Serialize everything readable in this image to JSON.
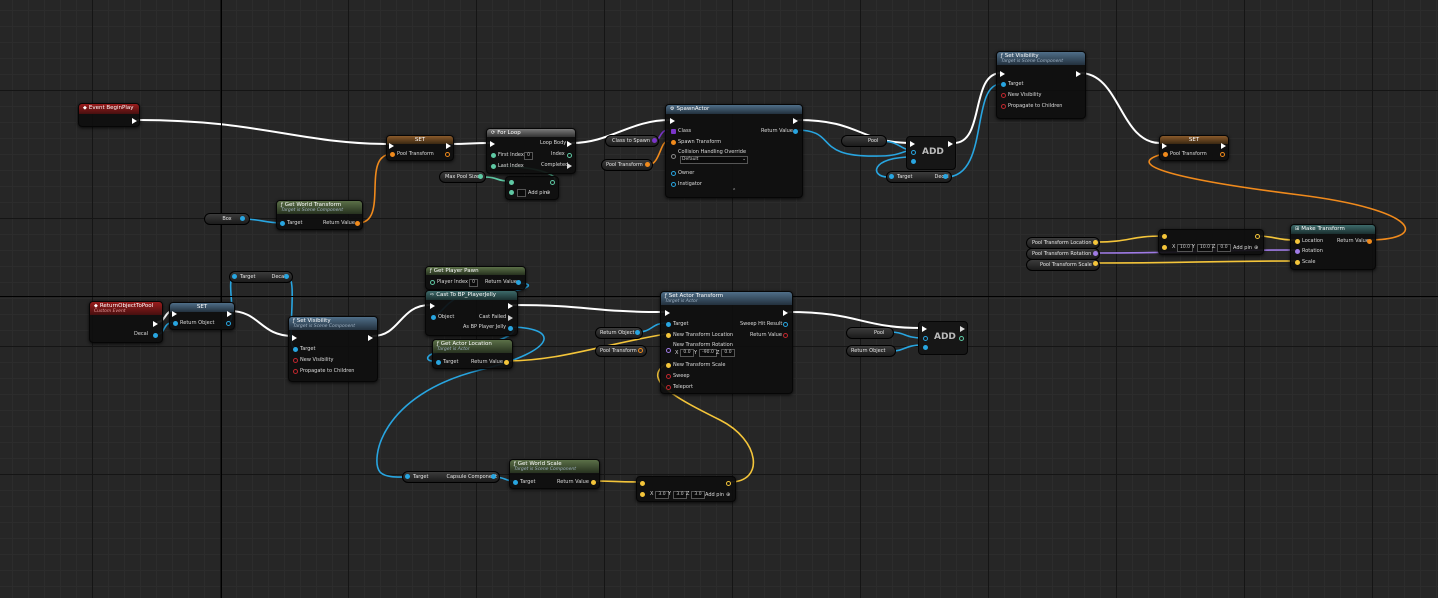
{
  "nodes": {
    "begin_play": {
      "title": "Event BeginPlay"
    },
    "set_pool_1": {
      "title": "SET",
      "pin": "Pool Transform"
    },
    "for_loop": {
      "title": "For Loop",
      "loop_body": "Loop Body",
      "first_index": "First Index",
      "first_index_val": "0",
      "index": "Index",
      "last_index": "Last Index",
      "completed": "Completed"
    },
    "max_pool_size": {
      "label": "Max Pool Size",
      "add_pin": "Add pin"
    },
    "get_world_transform": {
      "title": "Get World Transform",
      "subtitle": "Target is Scene Component",
      "target": "Target",
      "return": "Return Value"
    },
    "box": {
      "label": "Box"
    },
    "class_to_spawn": {
      "label": "Class to Spawn"
    },
    "pool_transform_var1": {
      "label": "Pool Transform"
    },
    "spawn_actor": {
      "title": "SpawnActor",
      "class": "Class",
      "spawn_transform": "Spawn Transform",
      "collision": "Collision Handling Override",
      "collision_val": "Default",
      "owner": "Owner",
      "instigator": "Instigator",
      "return": "Return Value"
    },
    "pool_get_1": {
      "label": "Pool"
    },
    "add_1": {
      "title": "ADD",
      "target": "Target",
      "decal": "Decal"
    },
    "set_visibility_top": {
      "title": "Set Visibility",
      "subtitle": "Target is Scene Component",
      "target": "Target",
      "new_visibility": "New Visibility",
      "propagate": "Propagate to Children"
    },
    "set_pool_2": {
      "title": "SET",
      "pin": "Pool Transform"
    },
    "make_transform": {
      "title": "Make Transform",
      "location": "Location",
      "rotation": "Rotation",
      "scale": "Scale",
      "return": "Return Value"
    },
    "vec_make": {
      "x": "10.0",
      "y": "10.0",
      "z": "0.0",
      "add_pin": "Add pin"
    },
    "pool_loc": {
      "label": "Pool Transform Location"
    },
    "pool_rot": {
      "label": "Pool Transform Rotation"
    },
    "pool_scale": {
      "label": "Pool Transform Scale"
    },
    "return_to_pool": {
      "title": "ReturnObjectToPool",
      "subtitle": "Custom Event",
      "decal": "Decal"
    },
    "set_return": {
      "title": "SET",
      "pin": "Return Object"
    },
    "target_decal": {
      "target": "Target",
      "decal": "Decal"
    },
    "set_visibility_bottom": {
      "title": "Set Visibility",
      "subtitle": "Target is Scene Component",
      "target": "Target",
      "new_visibility": "New Visibility",
      "propagate": "Propagate to Children"
    },
    "get_player_pawn": {
      "title": "Get Player Pawn",
      "player_index": "Player Index",
      "player_index_val": "0",
      "return": "Return Value"
    },
    "cast_jelly": {
      "title": "Cast To BP_PlayerJelly",
      "object": "Object",
      "cast_failed": "Cast Failed",
      "as": "As BP Player Jelly"
    },
    "get_actor_location": {
      "title": "Get Actor Location",
      "subtitle": "Target is Actor",
      "target": "Target",
      "return": "Return Value"
    },
    "set_actor_transform": {
      "title": "Set Actor Transform",
      "subtitle": "Target is Actor",
      "target": "Target",
      "sweep_hit": "Sweep Hit Result",
      "new_loc": "New Transform Location",
      "return": "Return Value",
      "new_rot": "New Transform Rotation",
      "rx": "0.0",
      "ry": "-90.0",
      "rz": "0.0",
      "new_scale": "New Transform Scale",
      "sweep": "Sweep",
      "teleport": "Teleport"
    },
    "return_object_var": {
      "label": "Return Object"
    },
    "pool_transform_var2": {
      "label": "Pool Transform"
    },
    "pool_get_2": {
      "label": "Pool"
    },
    "return_object_var2": {
      "label": "Return Object"
    },
    "add_2": {
      "title": "ADD"
    },
    "target_capsule": {
      "target": "Target",
      "capsule": "Capsule Component"
    },
    "get_world_scale": {
      "title": "Get World Scale",
      "subtitle": "Target is Scene Component",
      "target": "Target",
      "return": "Return Value"
    },
    "vec_scale": {
      "x": "3.0",
      "y": "3.0",
      "z": "3.0",
      "add_pin": "Add pin"
    }
  },
  "colors": {
    "exec": "#ffffff",
    "object": "#28a5e0",
    "transform": "#f08a1c",
    "vector": "#f4c53a",
    "rotator": "#9f7be5",
    "bool": "#c0272d",
    "int": "#5fc9a4",
    "class": "#7a35c9"
  }
}
